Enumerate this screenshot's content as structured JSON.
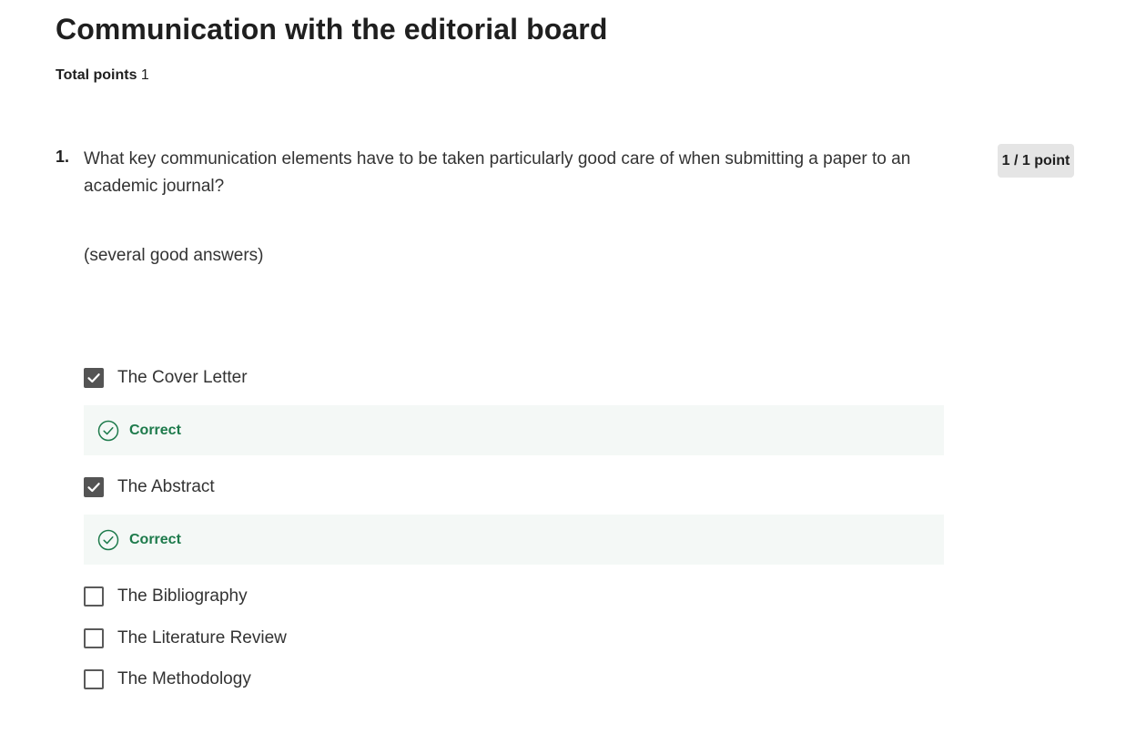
{
  "page": {
    "title": "Communication with the editorial board",
    "total_points_label": "Total points",
    "total_points_value": "1"
  },
  "question": {
    "number": "1.",
    "text": "What key communication elements have to be taken particularly good care of when submitting a paper to an academic journal?",
    "note": "(several good answers)",
    "score": "1 / 1 point",
    "options": [
      {
        "label": "The Cover Letter",
        "checked": true,
        "feedback": "Correct"
      },
      {
        "label": "The Abstract",
        "checked": true,
        "feedback": "Correct"
      },
      {
        "label": "The Bibliography",
        "checked": false
      },
      {
        "label": "The Literature Review",
        "checked": false
      },
      {
        "label": "The Methodology",
        "checked": false
      }
    ]
  },
  "colors": {
    "correct_text": "#1d7a4b",
    "feedback_background": "#f4f8f6",
    "checkbox_checked": "#545454",
    "score_badge": "#e5e5e5"
  },
  "icons": {
    "checked": "check-icon",
    "feedback": "check-circle-icon"
  }
}
